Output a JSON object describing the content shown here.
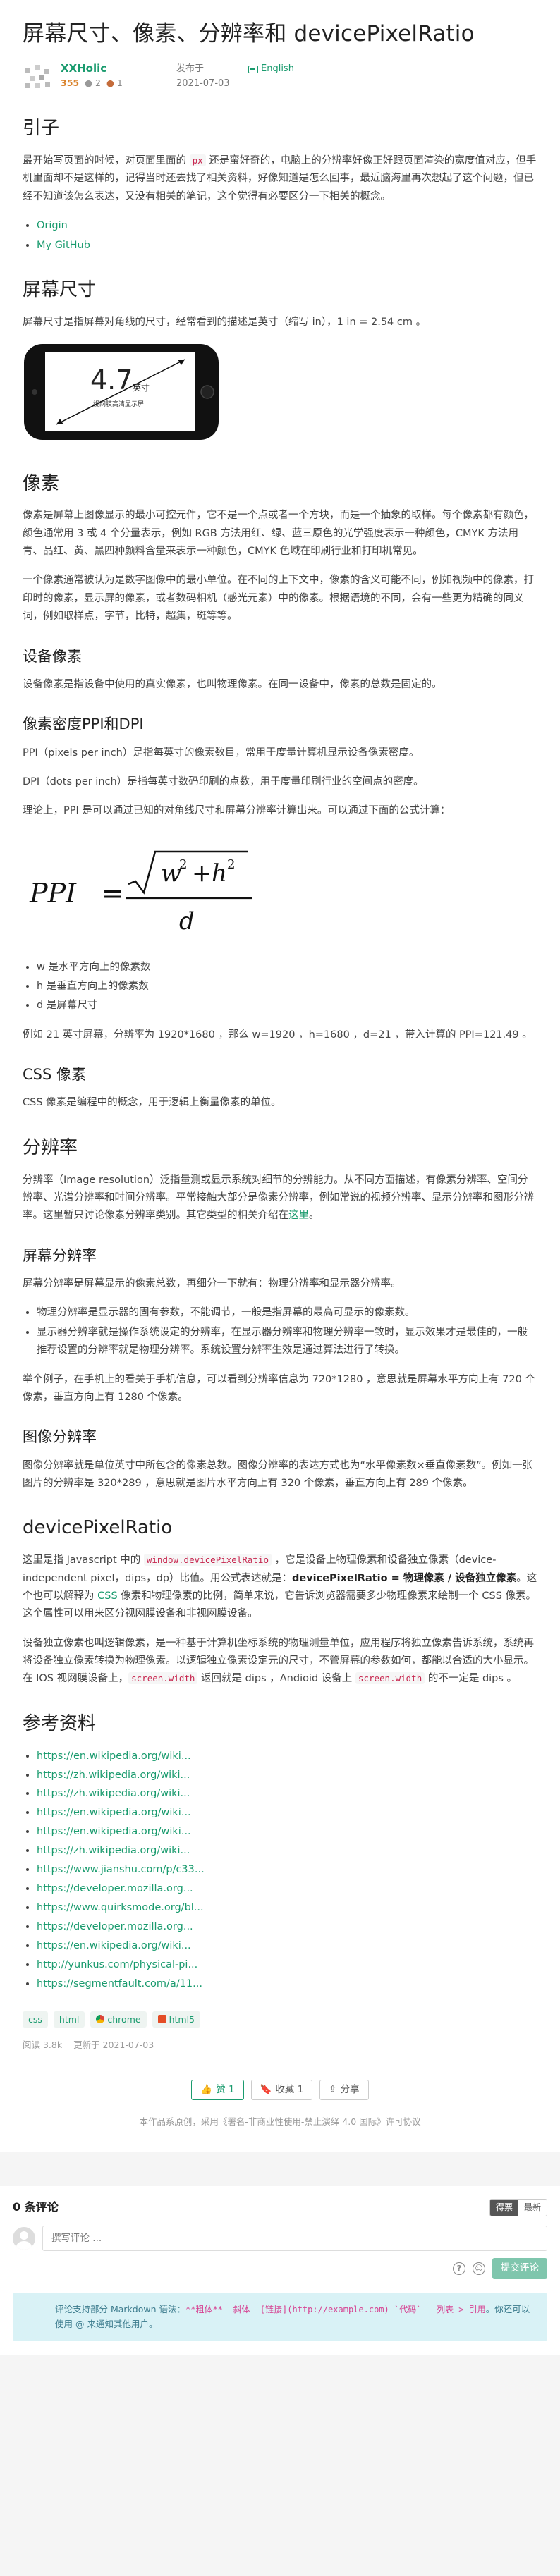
{
  "title": "屏幕尺寸、像素、分辨率和 devicePixelRatio",
  "author": {
    "name": "XXHolic",
    "reputation": "355",
    "silver": "2",
    "bronze": "1"
  },
  "published": {
    "label": "发布于",
    "date": "2021-07-03"
  },
  "language": "English",
  "sections": {
    "intro": {
      "heading": "引子",
      "p1_a": "最开始写页面的时候，对页面里面的 ",
      "p1_code": "px",
      "p1_b": " 还是蛮好奇的，电脑上的分辨率好像正好跟页面渲染的宽度值对应，但手机里面却不是这样的，记得当时还去找了相关资料，好像知道是怎么回事，最近脑海里再次想起了这个问题，但已经不知道该怎么表达，又没有相关的笔记，这个觉得有必要区分一下相关的概念。",
      "links": [
        "Origin",
        "My GitHub"
      ]
    },
    "screen_size": {
      "heading": "屏幕尺寸",
      "p1": "屏幕尺寸是指屏幕对角线的尺寸，经常看到的描述是英寸（缩写 in），1 in = 2.54 cm 。",
      "phone_value": "4.7",
      "phone_unit": "英寸",
      "phone_caption": "视网膜高清显示屏"
    },
    "pixel": {
      "heading": "像素",
      "p1": "像素是屏幕上图像显示的最小可控元件，它不是一个点或者一个方块，而是一个抽象的取样。每个像素都有颜色，颜色通常用 3 或 4 个分量表示，例如 RGB 方法用红、绿、蓝三原色的光学强度表示一种颜色，CMYK 方法用青、品红、黄、黑四种颜料含量来表示一种颜色，CMYK 色域在印刷行业和打印机常见。",
      "p2": "一个像素通常被认为是数字图像中的最小单位。在不同的上下文中，像素的含义可能不同，例如视频中的像素，打印时的像素，显示屏的像素，或者数码相机（感光元素）中的像素。根据语境的不同，会有一些更为精确的同义词，例如取样点，字节，比特，超集，斑等等。"
    },
    "device_pixel": {
      "heading": "设备像素",
      "p1": "设备像素是指设备中使用的真实像素，也叫物理像素。在同一设备中，像素的总数是固定的。"
    },
    "ppi": {
      "heading": "像素密度PPI和DPI",
      "p1": "PPI（pixels per inch）是指每英寸的像素数目，常用于度量计算机显示设备像素密度。",
      "p2": "DPI（dots per inch）是指每英寸数码印刷的点数，用于度量印刷行业的空间点的密度。",
      "p3": "理论上，PPI 是可以通过已知的对角线尺寸和屏幕分辨率计算出来。可以通过下面的公式计算：",
      "formula": {
        "lhs": "PPI",
        "num_a": "w",
        "num_b": "h",
        "exp": "2",
        "den": "d"
      },
      "list": [
        "w 是水平方向上的像素数",
        "h 是垂直方向上的像素数",
        "d 是屏幕尺寸"
      ],
      "p4": "例如 21 英寸屏幕，分辨率为 1920*1680 ，那么 w=1920 ，h=1680 ，d=21 ，带入计算的 PPI=121.49 。"
    },
    "css_pixel": {
      "heading": "CSS 像素",
      "p1": "CSS 像素是编程中的概念，用于逻辑上衡量像素的单位。"
    },
    "resolution": {
      "heading": "分辨率",
      "p1_a": "分辨率（Image resolution）泛指量测或显示系统对细节的分辨能力。从不同方面描述，有像素分辨率、空间分辨率、光谱分辨率和时间分辨率。平常接触大部分是像素分辨率，例如常说的视频分辨率、显示分辨率和图形分辨率。这里暂只讨论像素分辨率类别。其它类型的相关介绍在",
      "p1_link": "这里",
      "p1_b": "。"
    },
    "screen_resolution": {
      "heading": "屏幕分辨率",
      "p1": "屏幕分辨率是屏幕显示的像素总数，再细分一下就有：物理分辨率和显示器分辨率。",
      "list": [
        "物理分辨率是显示器的固有参数，不能调节，一般是指屏幕的最高可显示的像素数。",
        "显示器分辨率就是操作系统设定的分辨率，在显示器分辨率和物理分辨率一致时，显示效果才是最佳的，一般推荐设置的分辨率就是物理分辨率。系统设置分辨率生效是通过算法进行了转换。"
      ],
      "p2": "举个例子，在手机上的看关于手机信息，可以看到分辨率信息为 720*1280 ，意思就是屏幕水平方向上有 720 个像素，垂直方向上有 1280 个像素。"
    },
    "image_resolution": {
      "heading": "图像分辨率",
      "p1": "图像分辨率就是单位英寸中所包含的像素总数。图像分辨率的表达方式也为“水平像素数×垂直像素数”。例如一张图片的分辨率是 320*289 ，意思就是图片水平方向上有 320 个像素，垂直方向上有 289 个像素。"
    },
    "dpr": {
      "heading": "devicePixelRatio",
      "p1_a": "这里是指 Javascript 中的 ",
      "p1_code": "window.devicePixelRatio",
      "p1_b": " ，它是设备上物理像素和设备独立像素（device-independent pixel，dips，dp）比值。用公式表达就是：",
      "p1_strong": "devicePixelRatio = 物理像素 / 设备独立像素",
      "p1_c": "。这个也可以解释为 ",
      "p1_link": "CSS",
      "p1_d": " 像素和物理像素的比例，简单来说，它告诉浏览器需要多少物理像素来绘制一个 CSS 像素。这个属性可以用来区分视网膜设备和非视网膜设备。",
      "p2_a": "设备独立像素也叫逻辑像素，是一种基于计算机坐标系统的物理测量单位，应用程序将独立像素告诉系统，系统再将设备独立像素转换为物理像素。以逻辑独立像素设定元的尺寸，不管屏幕的参数如何，都能以合适的大小显示。在 IOS 视网膜设备上，",
      "p2_code1": "screen.width",
      "p2_b": " 返回就是 dips ，Andioid 设备上 ",
      "p2_code2": "screen.width",
      "p2_c": " 的不一定是 dips 。"
    },
    "references": {
      "heading": "参考资料",
      "links": [
        "https://en.wikipedia.org/wiki...",
        "https://zh.wikipedia.org/wiki...",
        "https://zh.wikipedia.org/wiki...",
        "https://en.wikipedia.org/wiki...",
        "https://en.wikipedia.org/wiki...",
        "https://zh.wikipedia.org/wiki...",
        "https://www.jianshu.com/p/c33...",
        "https://developer.mozilla.org...",
        "https://www.quirksmode.org/bl...",
        "https://developer.mozilla.org...",
        "https://en.wikipedia.org/wiki...",
        "http://yunkus.com/physical-pi...",
        "https://segmentfault.com/a/11..."
      ]
    }
  },
  "tags": [
    "css",
    "html",
    "chrome",
    "html5"
  ],
  "stats": {
    "reads": "阅读 3.8k",
    "updated": "更新于 2021-07-03"
  },
  "actions": {
    "like": "赞 1",
    "collect": "收藏 1",
    "share": "分享"
  },
  "license": "本作品系原创，采用《署名-非商业性使用-禁止演绎 4.0 国际》许可协议",
  "comments": {
    "count": "0 条评论",
    "sort_hot": "得票",
    "sort_new": "最新",
    "placeholder": "撰写评论 ...",
    "submit": "提交评论",
    "hint_a": "评论支持部分 Markdown 语法：",
    "hint_code": "**粗体** _斜体_ [链接](http://example.com) `代码` - 列表 > 引用",
    "hint_b": "。你还可以使用 @ 来通知其他用户。"
  },
  "colors": {
    "accent": "#1a9b6e",
    "code": "#c7254e",
    "hint_bg": "#d9f2f6"
  }
}
